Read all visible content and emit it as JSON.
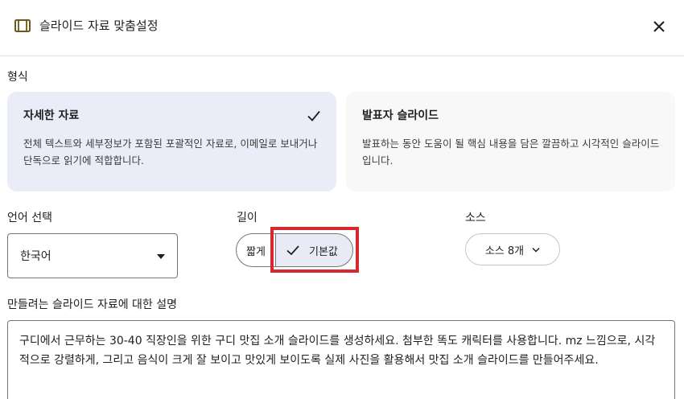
{
  "header": {
    "title": "슬라이드 자료 맞춤설정",
    "icon": "slides-icon",
    "close_icon": "close-icon"
  },
  "format": {
    "label": "형식",
    "options": [
      {
        "title": "자세한 자료",
        "description": "전체 텍스트와 세부정보가 포함된 포괄적인 자료로, 이메일로 보내거나 단독으로 읽기에 적합합니다.",
        "selected": true
      },
      {
        "title": "발표자 슬라이드",
        "description": "발표하는 동안 도움이 될 핵심 내용을 담은 깔끔하고 시각적인 슬라이드입니다.",
        "selected": false
      }
    ]
  },
  "language": {
    "label": "언어 선택",
    "value": "한국어"
  },
  "length": {
    "label": "길이",
    "options": [
      "짧게",
      "기본값"
    ],
    "selected": "기본값"
  },
  "source": {
    "label": "소스",
    "button_label": "소스 8개"
  },
  "description": {
    "label": "만들려는 슬라이드 자료에 대한 설명",
    "value": "구디에서 근무하는 30-40 직장인을 위한 구디 맛집 소개 슬라이드를 생성하세요. 첨부한 똑도 캐릭터를 사용합니다. mz 느낌으로, 시각적으로 강렬하게, 그리고 음식이 크게 잘 보이고 맛있게 보이도록 실제 사진을 활용해서 맛집 소개 슬라이드를 만들어주세요."
  },
  "colors": {
    "selected_card": "#eaecf8",
    "highlight": "#d6282e"
  }
}
